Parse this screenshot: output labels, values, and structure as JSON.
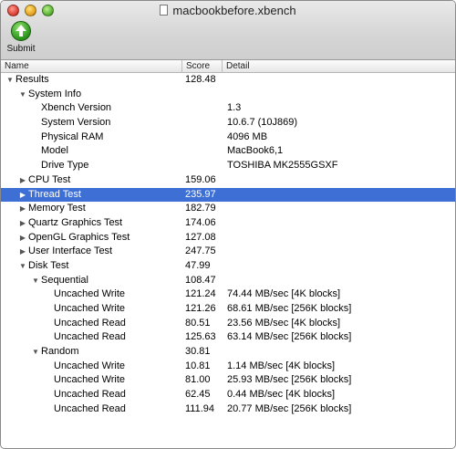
{
  "window": {
    "title": "macbookbefore.xbench"
  },
  "toolbar": {
    "submit_label": "Submit"
  },
  "columns": {
    "name": "Name",
    "score": "Score",
    "detail": "Detail"
  },
  "colors": {
    "selection": "#3d6fd5",
    "submit_green": "#2f9a20"
  },
  "rows": [
    {
      "name": "Results",
      "score": "128.48",
      "detail": "",
      "indent": 0,
      "disclosure": "open",
      "selected": false
    },
    {
      "name": "System Info",
      "score": "",
      "detail": "",
      "indent": 1,
      "disclosure": "open",
      "selected": false
    },
    {
      "name": "Xbench Version",
      "score": "",
      "detail": "1.3",
      "indent": 2,
      "disclosure": "none",
      "selected": false
    },
    {
      "name": "System Version",
      "score": "",
      "detail": "10.6.7 (10J869)",
      "indent": 2,
      "disclosure": "none",
      "selected": false
    },
    {
      "name": "Physical RAM",
      "score": "",
      "detail": "4096 MB",
      "indent": 2,
      "disclosure": "none",
      "selected": false
    },
    {
      "name": "Model",
      "score": "",
      "detail": "MacBook6,1",
      "indent": 2,
      "disclosure": "none",
      "selected": false
    },
    {
      "name": "Drive Type",
      "score": "",
      "detail": "TOSHIBA MK2555GSXF",
      "indent": 2,
      "disclosure": "none",
      "selected": false
    },
    {
      "name": "CPU Test",
      "score": "159.06",
      "detail": "",
      "indent": 1,
      "disclosure": "closed",
      "selected": false
    },
    {
      "name": "Thread Test",
      "score": "235.97",
      "detail": "",
      "indent": 1,
      "disclosure": "closed",
      "selected": true
    },
    {
      "name": "Memory Test",
      "score": "182.79",
      "detail": "",
      "indent": 1,
      "disclosure": "closed",
      "selected": false
    },
    {
      "name": "Quartz Graphics Test",
      "score": "174.06",
      "detail": "",
      "indent": 1,
      "disclosure": "closed",
      "selected": false
    },
    {
      "name": "OpenGL Graphics Test",
      "score": "127.08",
      "detail": "",
      "indent": 1,
      "disclosure": "closed",
      "selected": false
    },
    {
      "name": "User Interface Test",
      "score": "247.75",
      "detail": "",
      "indent": 1,
      "disclosure": "closed",
      "selected": false
    },
    {
      "name": "Disk Test",
      "score": "47.99",
      "detail": "",
      "indent": 1,
      "disclosure": "open",
      "selected": false
    },
    {
      "name": "Sequential",
      "score": "108.47",
      "detail": "",
      "indent": 2,
      "disclosure": "open",
      "selected": false
    },
    {
      "name": "Uncached Write",
      "score": "121.24",
      "detail": "74.44 MB/sec [4K blocks]",
      "indent": 3,
      "disclosure": "none",
      "selected": false
    },
    {
      "name": "Uncached Write",
      "score": "121.26",
      "detail": "68.61 MB/sec [256K blocks]",
      "indent": 3,
      "disclosure": "none",
      "selected": false
    },
    {
      "name": "Uncached Read",
      "score": "80.51",
      "detail": "23.56 MB/sec [4K blocks]",
      "indent": 3,
      "disclosure": "none",
      "selected": false
    },
    {
      "name": "Uncached Read",
      "score": "125.63",
      "detail": "63.14 MB/sec [256K blocks]",
      "indent": 3,
      "disclosure": "none",
      "selected": false
    },
    {
      "name": "Random",
      "score": "30.81",
      "detail": "",
      "indent": 2,
      "disclosure": "open",
      "selected": false
    },
    {
      "name": "Uncached Write",
      "score": "10.81",
      "detail": "1.14 MB/sec [4K blocks]",
      "indent": 3,
      "disclosure": "none",
      "selected": false
    },
    {
      "name": "Uncached Write",
      "score": "81.00",
      "detail": "25.93 MB/sec [256K blocks]",
      "indent": 3,
      "disclosure": "none",
      "selected": false
    },
    {
      "name": "Uncached Read",
      "score": "62.45",
      "detail": "0.44 MB/sec [4K blocks]",
      "indent": 3,
      "disclosure": "none",
      "selected": false
    },
    {
      "name": "Uncached Read",
      "score": "111.94",
      "detail": "20.77 MB/sec [256K blocks]",
      "indent": 3,
      "disclosure": "none",
      "selected": false
    }
  ]
}
